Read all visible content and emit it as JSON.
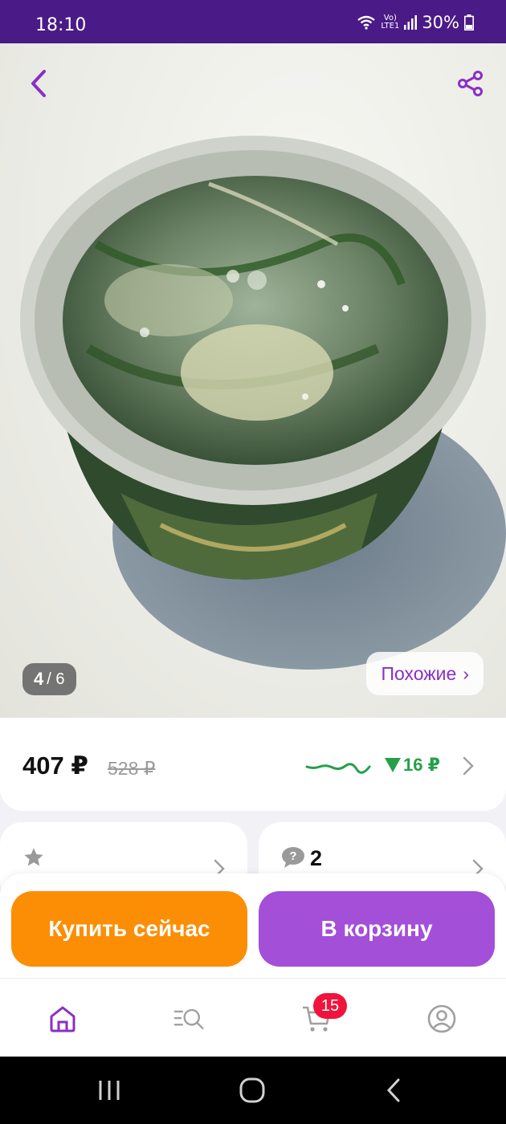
{
  "status_bar": {
    "time": "18:10",
    "network": "LTE1",
    "battery": "30%"
  },
  "gallery": {
    "current": "4",
    "total": "/ 6",
    "similar_label": "Похожие",
    "similar_chevron": "›"
  },
  "price_card": {
    "price": "407 ₽",
    "old_price": "528 ₽",
    "diff": "16 ₽",
    "trend_color": "#25a04a"
  },
  "reviews_card": {
    "count": ""
  },
  "questions_card": {
    "count": "2"
  },
  "actions": {
    "buy_now": "Купить сейчас",
    "add_to_cart": "В корзину"
  },
  "bottom_nav": {
    "cart_badge": "15"
  },
  "colors": {
    "status_bar": "#4a1a86",
    "accent": "#8a2fc7",
    "buy": "#fc8e06",
    "cart": "#a34fd8",
    "badge": "#f0143c"
  },
  "icons": [
    "back-icon",
    "share-icon",
    "star-icon",
    "question-icon",
    "home-icon",
    "catalog-search-icon",
    "cart-icon",
    "profile-icon"
  ]
}
